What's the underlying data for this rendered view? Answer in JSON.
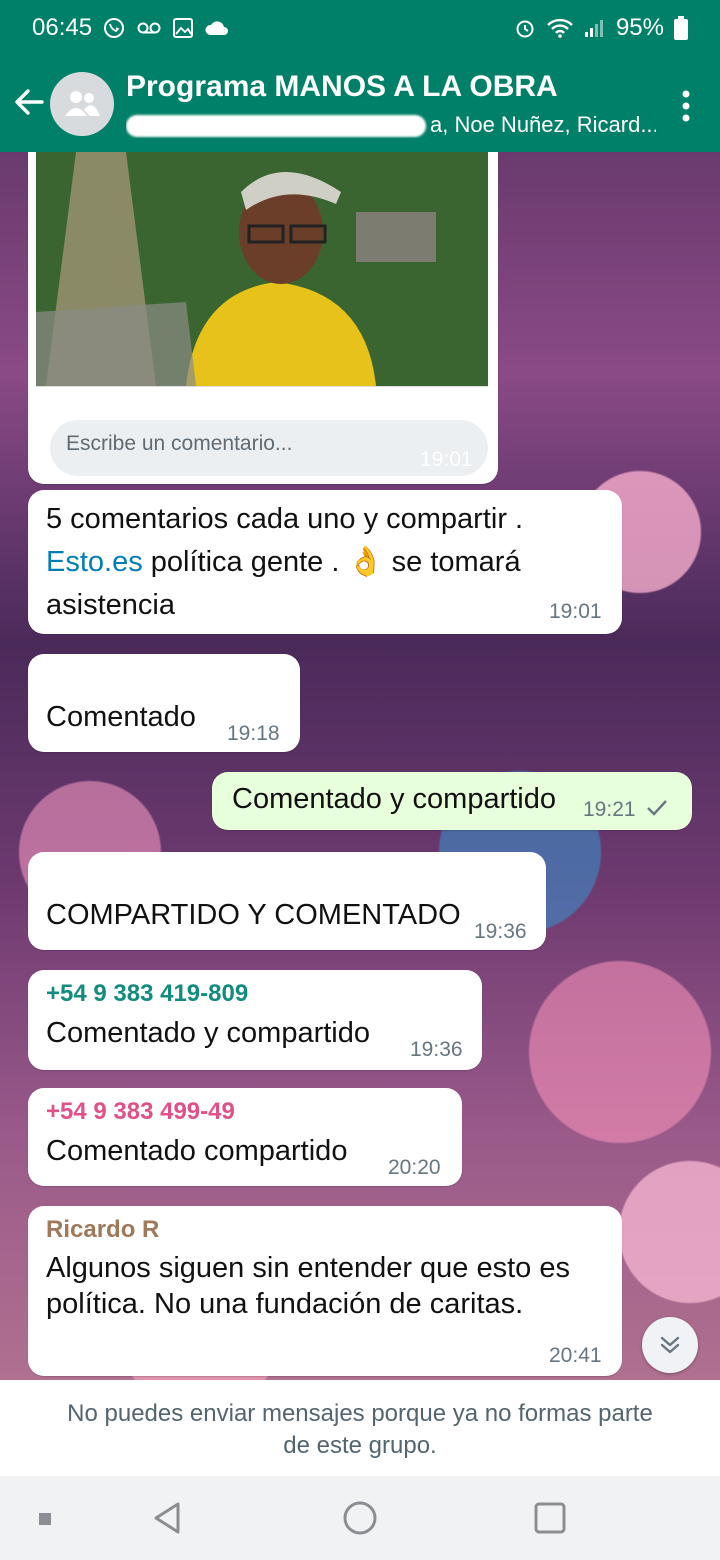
{
  "status_bar": {
    "time": "06:45",
    "battery": "95%"
  },
  "header": {
    "title": "Programa MANOS A LA OBRA",
    "members": "a, Noe Nuñez, Ricard..."
  },
  "image_message": {
    "comment_placeholder": "Escribe un comentario...",
    "time": "19:01"
  },
  "messages": [
    {
      "text_part1": "5 comentarios cada uno y compartir .",
      "link": "Esto.es",
      "text_part2": " política gente . ",
      "emoji": "👌",
      "text_part3": "  se tomará",
      "text_part4": "asistencia",
      "time": "19:01"
    },
    {
      "text": "Comentado",
      "time": "19:18"
    },
    {
      "text": "Comentado y compartido",
      "time": "19:21"
    },
    {
      "text": "COMPARTIDO Y COMENTADO",
      "time": "19:36"
    },
    {
      "sender": "+54 9 383 419-809",
      "text": "Comentado y compartido",
      "time": "19:36"
    },
    {
      "sender": "+54 9 383 499-49",
      "text": "Comentado compartido",
      "time": "20:20"
    },
    {
      "sender": "Ricardo R",
      "line1": "Algunos siguen sin entender que esto es",
      "line2": "política. No una fundación de caritas.",
      "time": "20:41"
    }
  ],
  "footer": {
    "line1": "No puedes enviar mensajes porque ya no formas parte",
    "line2": "de este grupo."
  },
  "colors": {
    "header": "#008069",
    "outgoing_bubble": "#e7ffdb",
    "sender_teal": "#128c7e",
    "sender_pink": "#e0508a",
    "sender_brown": "#a0785a"
  }
}
